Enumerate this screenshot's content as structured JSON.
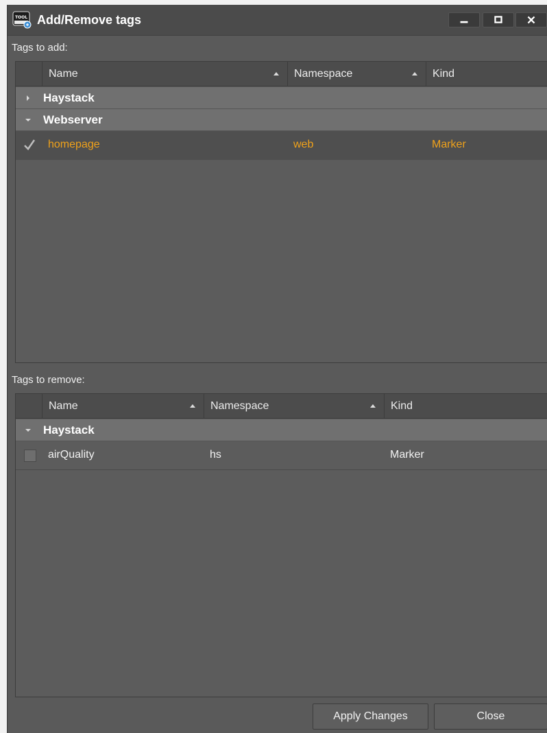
{
  "window": {
    "title": "Add/Remove tags",
    "app_icon_text": "TOOL"
  },
  "add_section": {
    "label": "Tags to add:",
    "columns": [
      "Name",
      "Namespace",
      "Kind"
    ],
    "groups": [
      {
        "name": "Haystack",
        "expanded": false
      },
      {
        "name": "Webserver",
        "expanded": true
      }
    ],
    "rows": [
      {
        "checked": true,
        "name": "homepage",
        "namespace": "web",
        "kind": "Marker"
      }
    ]
  },
  "remove_section": {
    "label": "Tags to remove:",
    "columns": [
      "Name",
      "Namespace",
      "Kind"
    ],
    "groups": [
      {
        "name": "Haystack",
        "expanded": true
      }
    ],
    "rows": [
      {
        "checked": false,
        "name": "airQuality",
        "namespace": "hs",
        "kind": "Marker"
      }
    ]
  },
  "buttons": {
    "apply": "Apply Changes",
    "close": "Close"
  },
  "colors": {
    "selected_text": "#f0a21a",
    "window_bg": "#5a5a5a",
    "group_bg": "#707070"
  }
}
